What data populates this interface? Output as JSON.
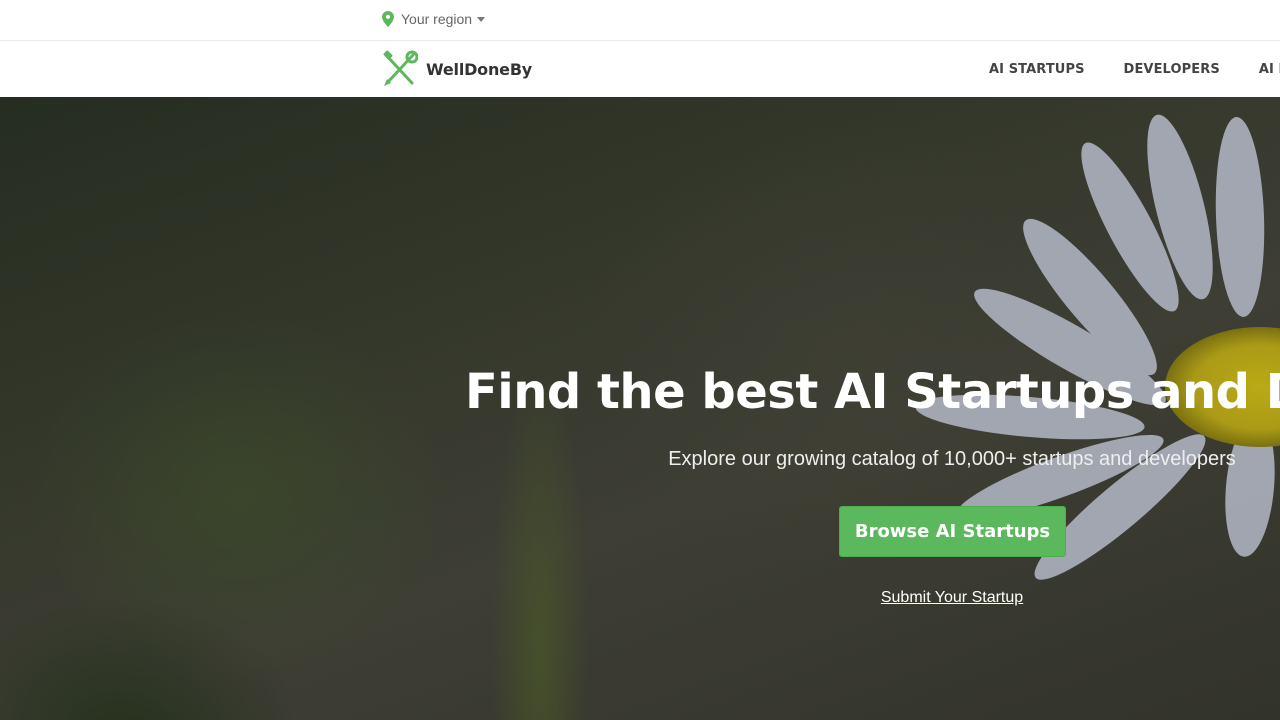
{
  "topbar": {
    "region_label": "Your region",
    "region_icon": "map-pin-icon",
    "caret_icon": "caret-down-icon"
  },
  "brand": {
    "name": "WellDoneBy",
    "logo_icon": "tools-icon",
    "color": "#5cb85c"
  },
  "nav": {
    "items": [
      "AI STARTUPS",
      "DEVELOPERS",
      "AI BLOG"
    ]
  },
  "hero": {
    "title": "Find the best AI Startups and Developers",
    "subtitle": "Explore our growing catalog of 10,000+ startups and developers",
    "cta_label": "Browse AI Startups",
    "submit_link": "Submit Your Startup",
    "accent_color": "#5cb85c"
  }
}
